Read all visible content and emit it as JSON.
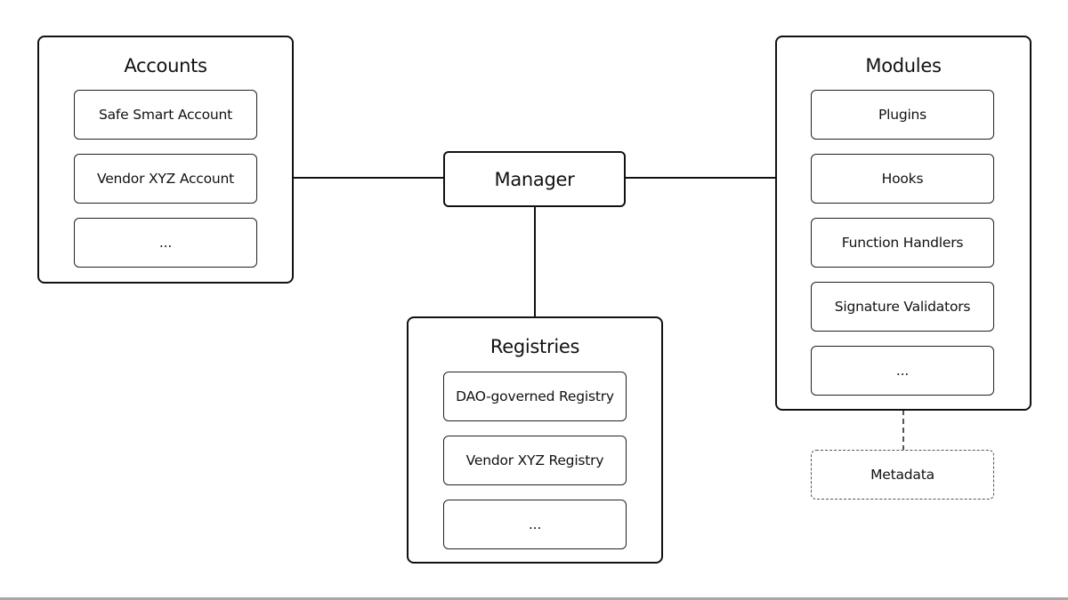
{
  "diagram": {
    "manager": {
      "label": "Manager"
    },
    "accounts": {
      "title": "Accounts",
      "items": [
        "Safe Smart Account",
        "Vendor XYZ Account",
        "..."
      ]
    },
    "modules": {
      "title": "Modules",
      "items": [
        "Plugins",
        "Hooks",
        "Function Handlers",
        "Signature Validators",
        "..."
      ],
      "attachment": {
        "label": "Metadata",
        "style": "dashed"
      }
    },
    "registries": {
      "title": "Registries",
      "items": [
        "DAO-governed Registry",
        "Vendor XYZ Registry",
        "..."
      ]
    },
    "connections": [
      {
        "from": "Accounts",
        "to": "Manager",
        "style": "solid"
      },
      {
        "from": "Manager",
        "to": "Modules",
        "style": "solid"
      },
      {
        "from": "Manager",
        "to": "Registries",
        "style": "solid"
      },
      {
        "from": "Modules",
        "to": "Metadata",
        "style": "dashed"
      }
    ]
  }
}
